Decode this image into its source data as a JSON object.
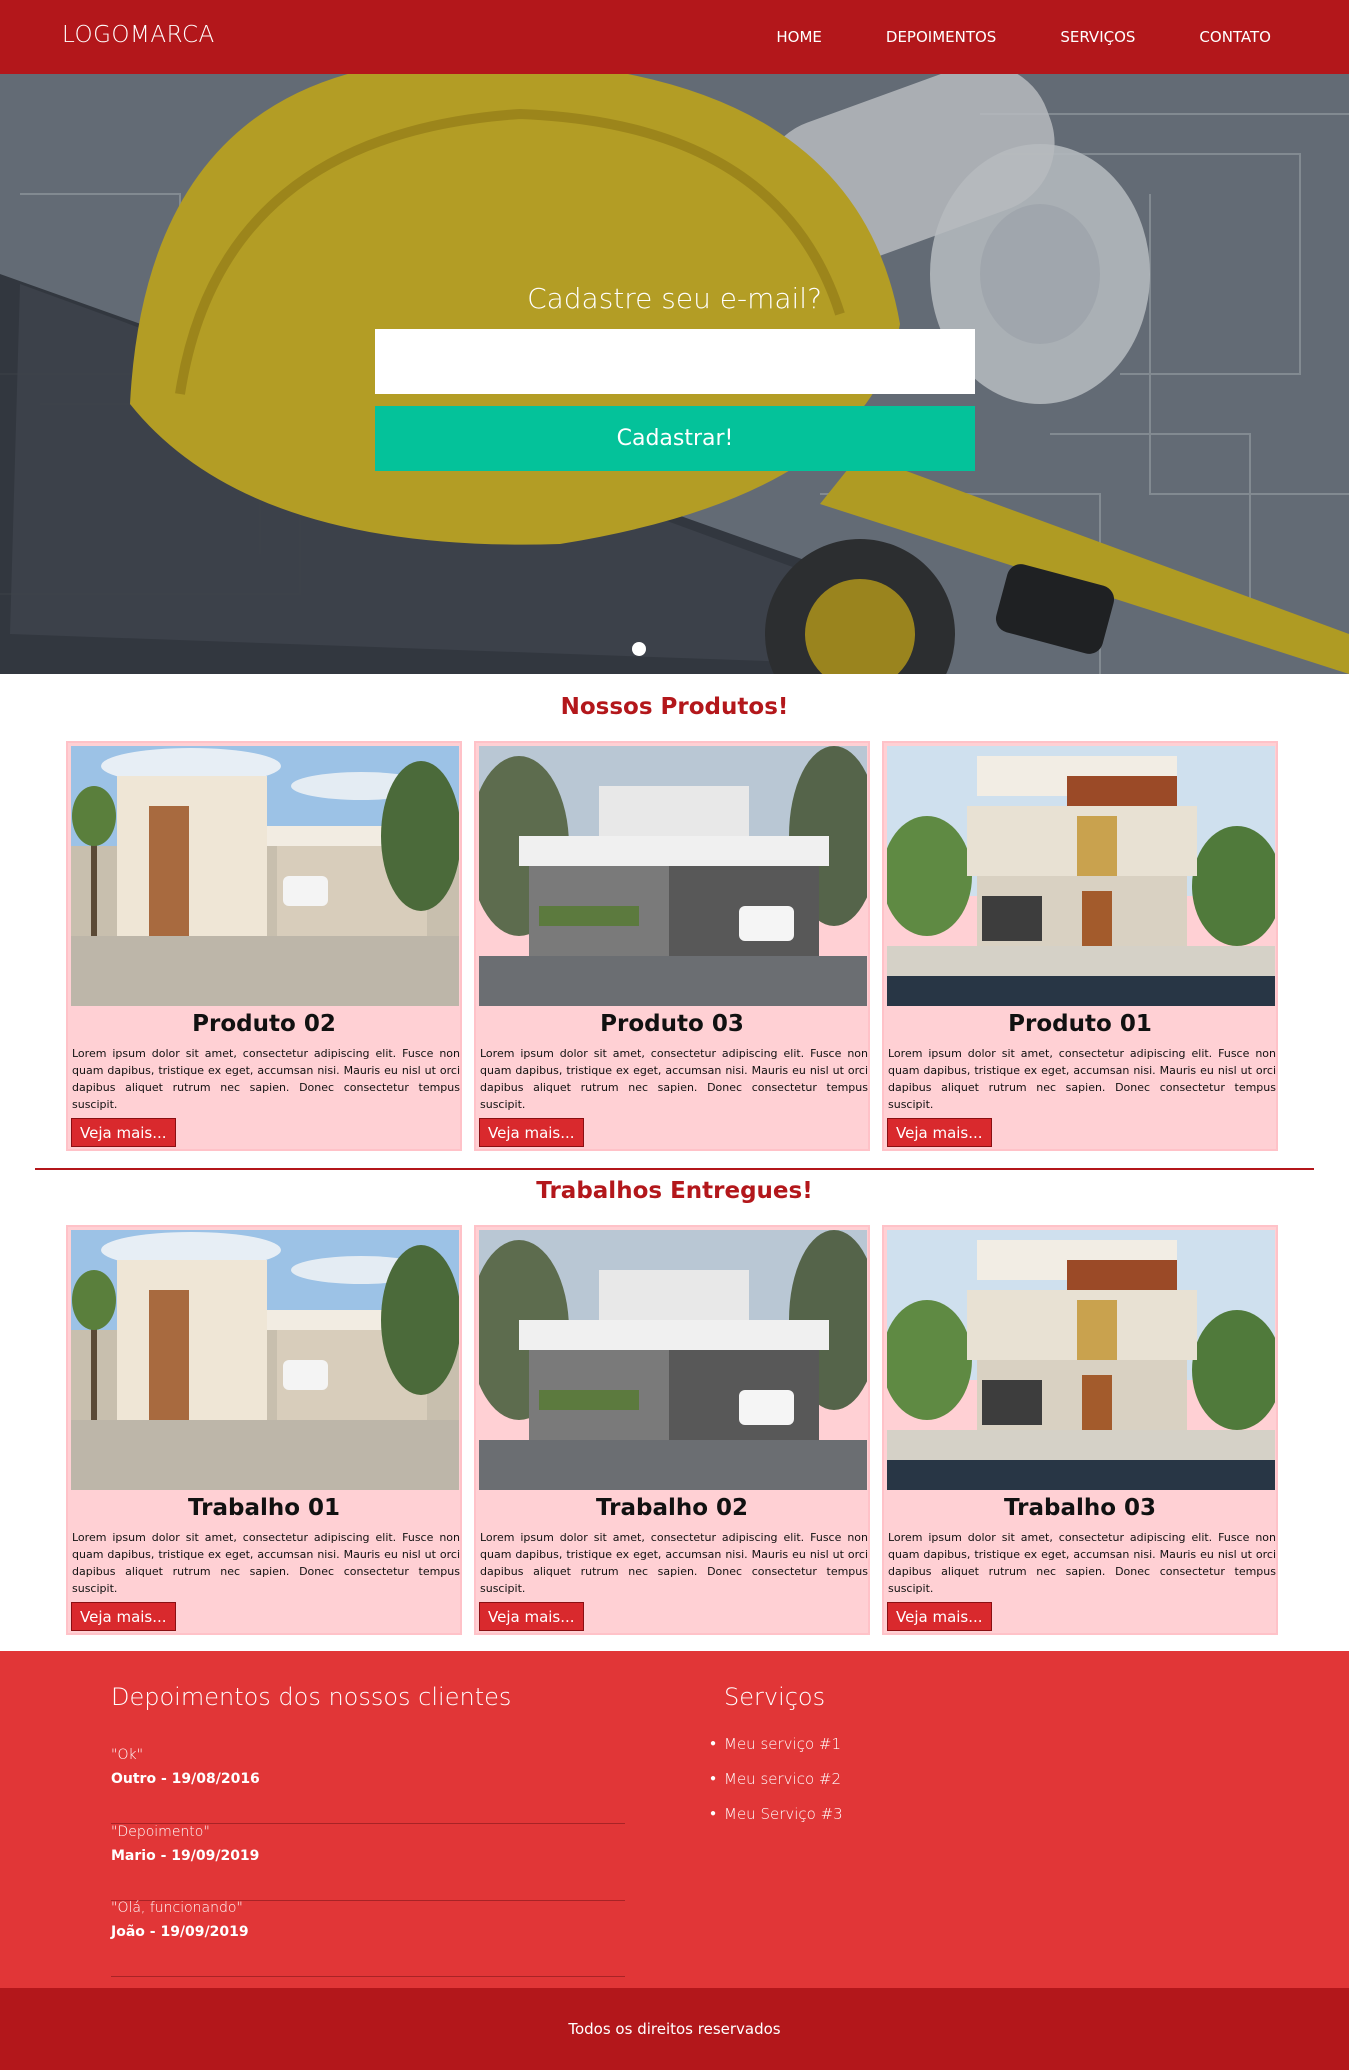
{
  "nav": {
    "logo": "LOGOMARCA",
    "items": [
      "HOME",
      "DEPOIMENTOS",
      "SERVIÇOS",
      "CONTATO"
    ]
  },
  "hero": {
    "title": "Cadastre seu e-mail?",
    "input_placeholder": "",
    "button": "Cadastrar!"
  },
  "produtos": {
    "title": "Nossos Produtos!",
    "cards": [
      {
        "title": "Produto 02",
        "text": "Lorem ipsum dolor sit amet, consectetur adipiscing elit. Fusce non quam dapibus, tristique ex eget, accumsan nisi. Mauris eu nisl ut orci dapibus aliquet rutrum nec sapien. Donec consectetur tempus suscipit.",
        "button": "Veja mais..."
      },
      {
        "title": "Produto 03",
        "text": "Lorem ipsum dolor sit amet, consectetur adipiscing elit. Fusce non quam dapibus, tristique ex eget, accumsan nisi. Mauris eu nisl ut orci dapibus aliquet rutrum nec sapien. Donec consectetur tempus suscipit.",
        "button": "Veja mais..."
      },
      {
        "title": "Produto 01",
        "text": "Lorem ipsum dolor sit amet, consectetur adipiscing elit. Fusce non quam dapibus, tristique ex eget, accumsan nisi. Mauris eu nisl ut orci dapibus aliquet rutrum nec sapien. Donec consectetur tempus suscipit.",
        "button": "Veja mais..."
      }
    ]
  },
  "trabalhos": {
    "title": "Trabalhos Entregues!",
    "cards": [
      {
        "title": "Trabalho 01",
        "text": "Lorem ipsum dolor sit amet, consectetur adipiscing elit. Fusce non quam dapibus, tristique ex eget, accumsan nisi. Mauris eu nisl ut orci dapibus aliquet rutrum nec sapien. Donec consectetur tempus suscipit.",
        "button": "Veja mais..."
      },
      {
        "title": "Trabalho 02",
        "text": "Lorem ipsum dolor sit amet, consectetur adipiscing elit. Fusce non quam dapibus, tristique ex eget, accumsan nisi. Mauris eu nisl ut orci dapibus aliquet rutrum nec sapien. Donec consectetur tempus suscipit.",
        "button": "Veja mais..."
      },
      {
        "title": "Trabalho 03",
        "text": "Lorem ipsum dolor sit amet, consectetur adipiscing elit. Fusce non quam dapibus, tristique ex eget, accumsan nisi. Mauris eu nisl ut orci dapibus aliquet rutrum nec sapien. Donec consectetur tempus suscipit.",
        "button": "Veja mais..."
      }
    ]
  },
  "depoimentos": {
    "title": "Depoimentos dos nossos clientes",
    "items": [
      {
        "quote": "\"Ok\"",
        "author": "Outro - 19/08/2016"
      },
      {
        "quote": "\"Depoimento\"",
        "author": "Mario - 19/09/2019"
      },
      {
        "quote": "\"Olá, funcionando\"",
        "author": "João - 19/09/2019"
      }
    ]
  },
  "servicos": {
    "title": "Serviços",
    "items": [
      "Meu serviço #1",
      "Meu servico #2",
      "Meu Serviço #3"
    ]
  },
  "footer": {
    "copyright": "Todos os direitos reservados"
  },
  "colors": {
    "brand": "#b3171b",
    "footer": "#e13637",
    "cta": "#04c29a",
    "card": "#ffd0d4"
  }
}
